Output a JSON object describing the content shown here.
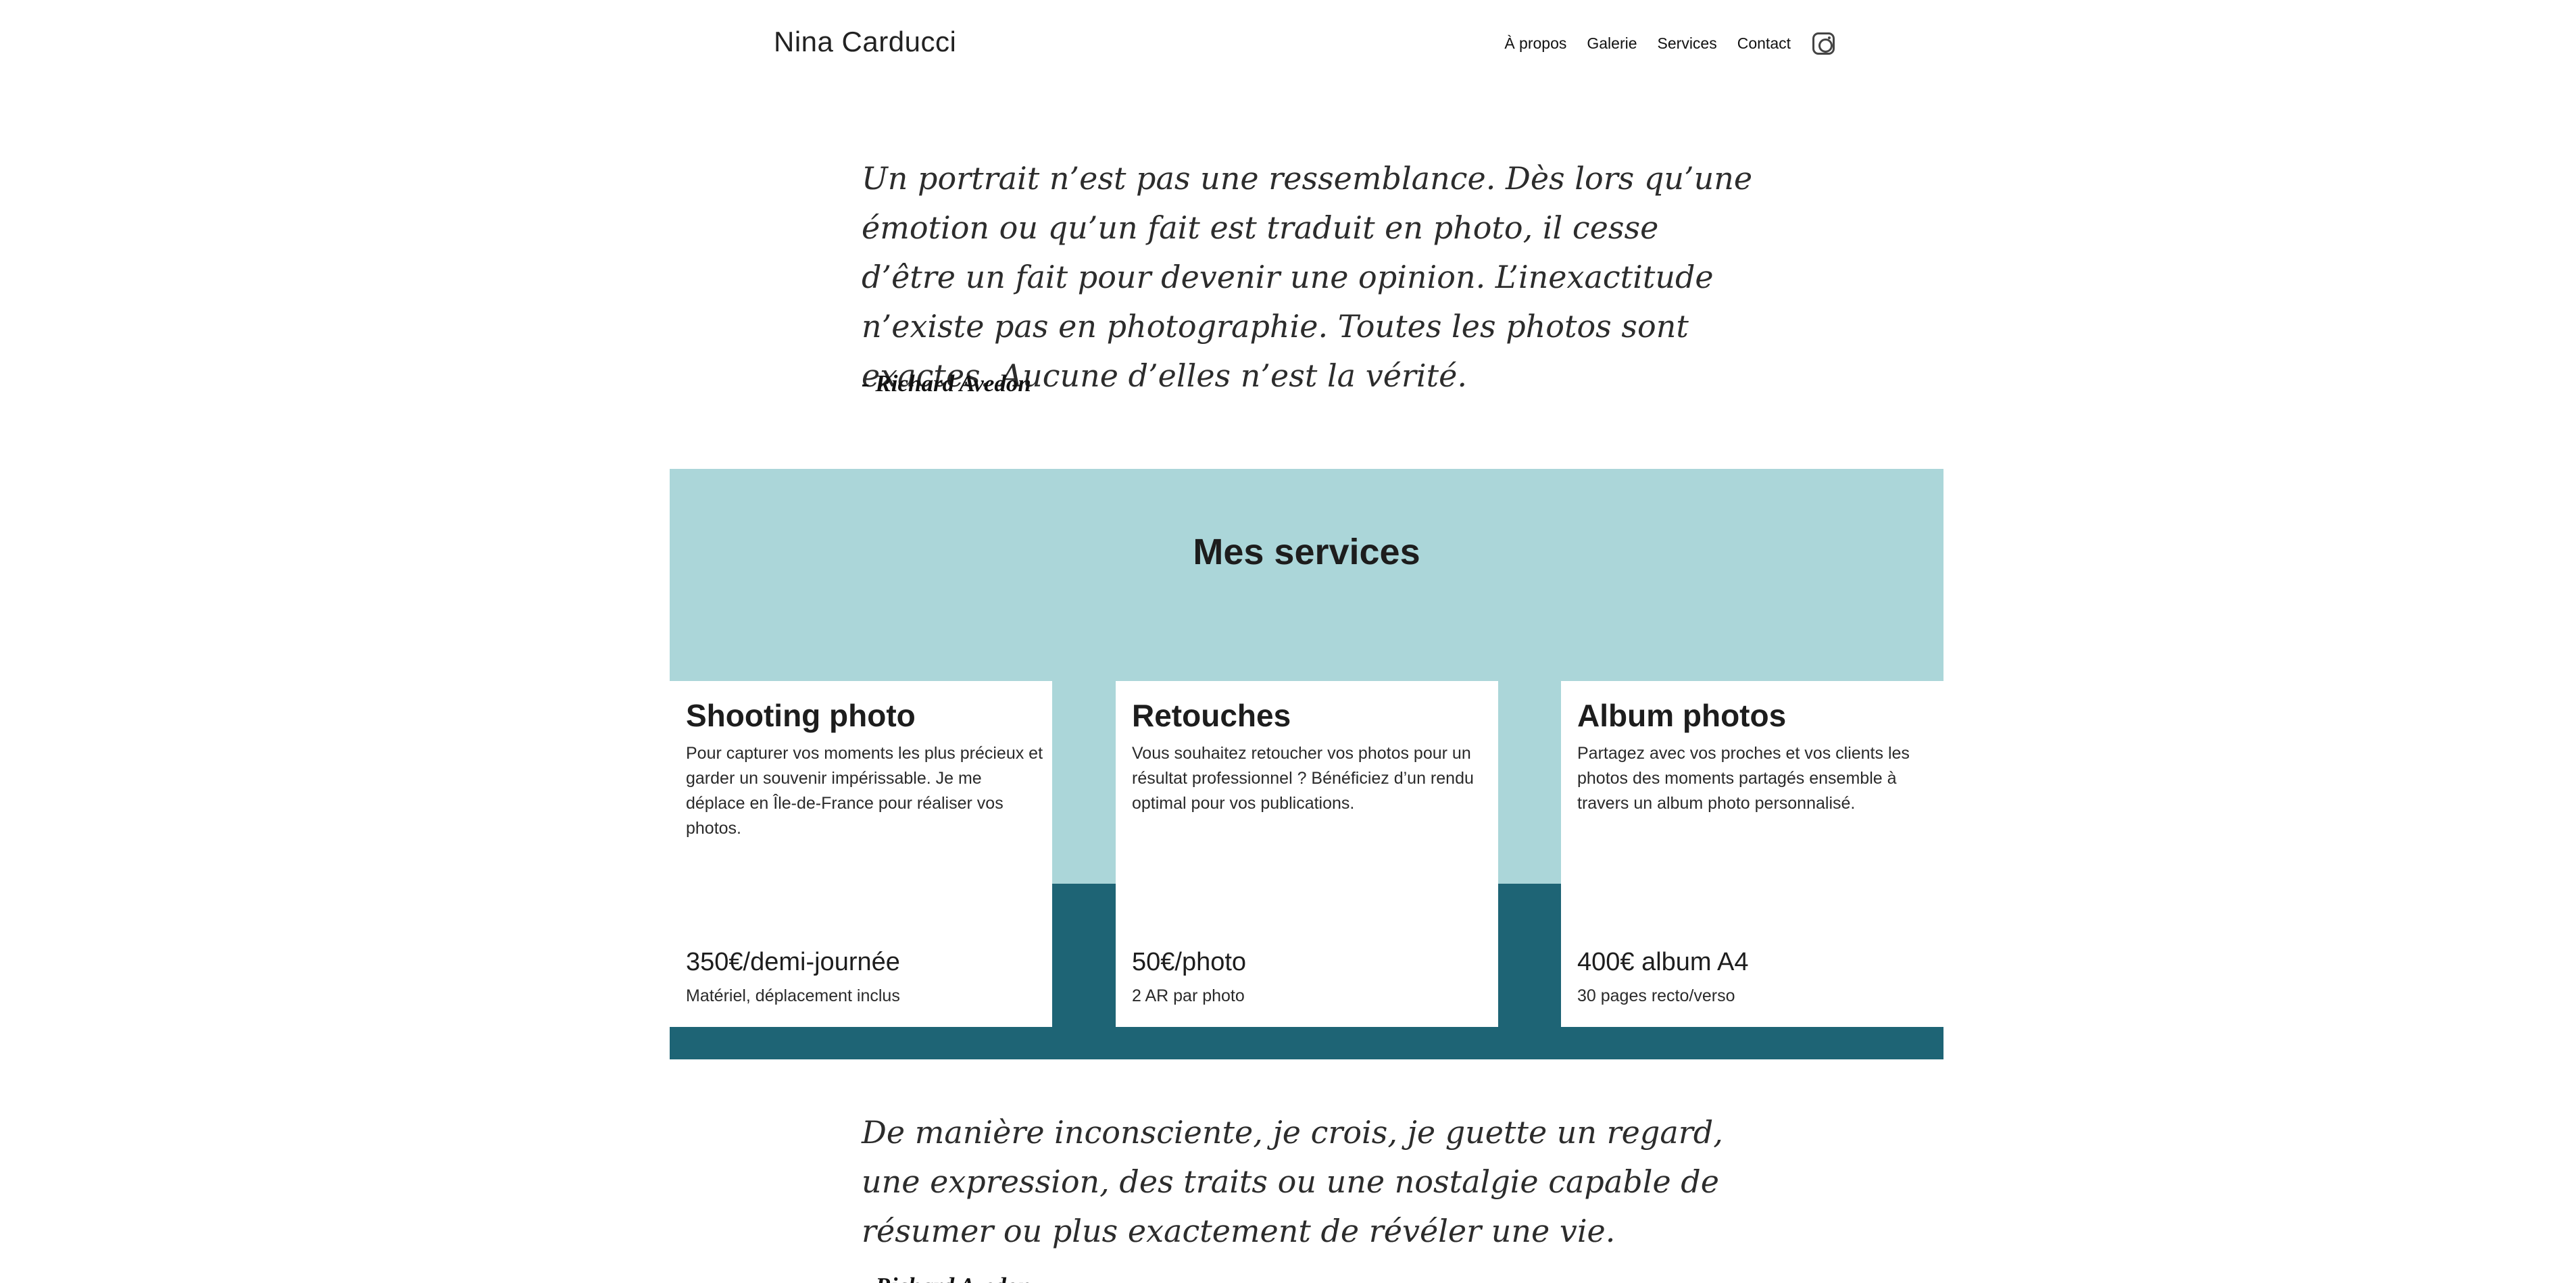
{
  "header": {
    "brand": "Nina Carducci",
    "nav": [
      "À propos",
      "Galerie",
      "Services",
      "Contact"
    ]
  },
  "quotes": [
    {
      "text": "Un portrait n’est pas une ressemblance. Dès lors qu’une émotion ou qu’un fait est traduit en photo, il cesse d’être un fait pour devenir une opinion. L’inexactitude n’existe pas en photographie. Toutes les photos sont exactes. Aucune d’elles n’est la vérité.",
      "author": "- Richard Avedon"
    },
    {
      "text": "De manière inconsciente, je crois, je guette un regard, une expression, des traits ou une nostalgie capable de résumer ou plus exactement de révéler une vie.",
      "author": "- Richard Avedon"
    }
  ],
  "services": {
    "title": "Mes services",
    "cards": [
      {
        "title": "Shooting photo",
        "text": "Pour capturer vos moments les plus précieux et garder un souvenir impérissable. Je me déplace en Île-de-France pour réaliser vos photos.",
        "price": "350€/demi-journée",
        "note": "Matériel, déplacement inclus"
      },
      {
        "title": "Retouches",
        "text": "Vous souhaitez retoucher vos photos pour un résultat professionnel ? Bénéficiez d’un rendu optimal pour vos publications.",
        "price": "50€/photo",
        "note": "2 AR par photo"
      },
      {
        "title": "Album photos",
        "text": "Partagez avec vos proches et vos clients les photos des moments partagés ensemble à travers un album photo personnalisé.",
        "price": "400€ album A4",
        "note": "30 pages recto/verso"
      }
    ]
  },
  "icons": {
    "social": "instagram-icon"
  },
  "colors": {
    "services_light": "#abd6d9",
    "services_dark": "#1e6475"
  }
}
